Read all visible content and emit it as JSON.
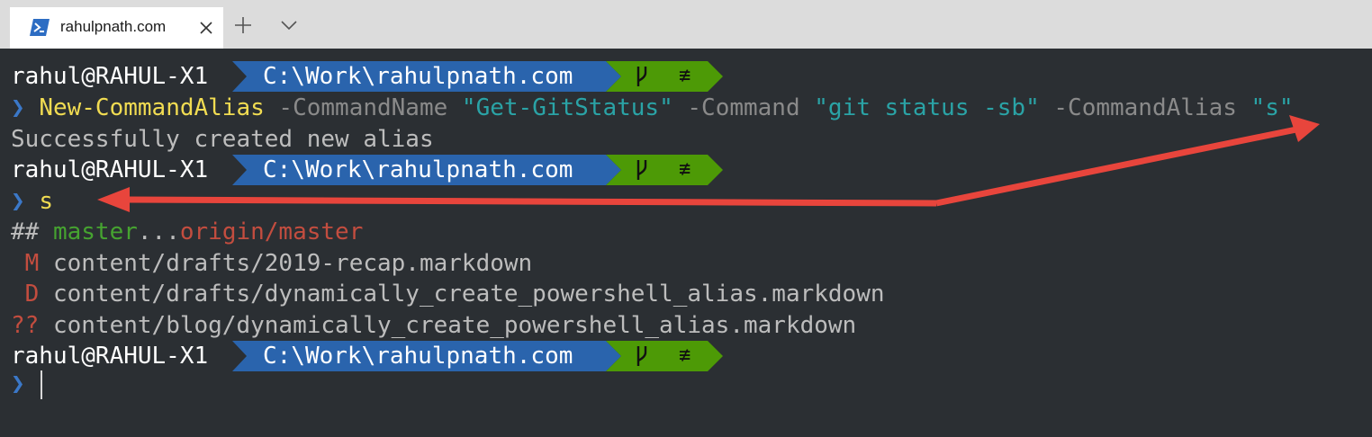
{
  "window": {
    "tab_title": "rahulpnath.com",
    "icons": {
      "app": "powershell-icon",
      "close": "close-icon",
      "new_tab": "plus-icon",
      "dropdown": "chevron-down-icon"
    }
  },
  "prompt": {
    "user": "rahul@RAHUL-X1",
    "path": "C:\\Work\\rahulpnath.com",
    "git_branch_icon": "git-branch-icon",
    "git_status_symbol": "≢",
    "chevron": "❯"
  },
  "commands": {
    "new_alias": {
      "cmdlet": "New-CommandAlias",
      "p1": "-CommandName",
      "v1": "\"Get-GitStatus\"",
      "p2": "-Command",
      "v2": "\"git status -sb\"",
      "p3": "-CommandAlias",
      "v3": "\"s\""
    },
    "new_alias_output": "Successfully created new alias",
    "alias_cmd": "s"
  },
  "git_status": {
    "header_prefix": "##",
    "local_branch": "master",
    "separator": "...",
    "remote_branch": "origin/master",
    "rows": [
      {
        "code": " M",
        "path": "content/drafts/2019-recap.markdown"
      },
      {
        "code": " D",
        "path": "content/drafts/dynamically_create_powershell_alias.markdown"
      },
      {
        "code": "??",
        "path": "content/blog/dynamically_create_powershell_alias.markdown"
      }
    ]
  },
  "colors": {
    "background": "#2b2f33",
    "path_segment": "#2a64ad",
    "git_segment": "#4d9a06",
    "chevron": "#3b78c8",
    "cmdlet": "#f1dc52",
    "string": "#2aa3a6",
    "annotation_arrow": "#e8453c"
  }
}
